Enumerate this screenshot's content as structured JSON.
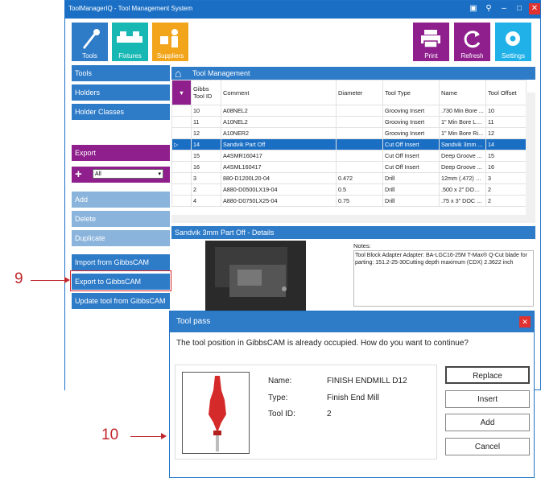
{
  "app": {
    "title": "ToolManagerIQ - Tool Management System"
  },
  "ribbon": {
    "left": [
      {
        "label": "Tools",
        "icon": "tools-icon",
        "color": "#2e7bc8"
      },
      {
        "label": "Fixtures",
        "icon": "fixtures-icon",
        "color": "#17b7b3"
      },
      {
        "label": "Suppliers",
        "icon": "suppliers-icon",
        "color": "#f2a51a"
      }
    ],
    "right": [
      {
        "label": "Print",
        "icon": "print-icon",
        "color": "#8e1f8c"
      },
      {
        "label": "Refresh",
        "icon": "refresh-icon",
        "color": "#8e1f8c"
      },
      {
        "label": "Settings",
        "icon": "gear-icon",
        "color": "#1fb1e8"
      }
    ]
  },
  "sidebar": {
    "nav": [
      "Tools",
      "Holders",
      "Holder Classes"
    ],
    "export_label": "Export",
    "filter_value": "All",
    "actions": [
      "Add",
      "Delete",
      "Duplicate"
    ],
    "gibbs": [
      "Import from GibbsCAM",
      "Export to GibbsCAM",
      "Update tool from GibbsCAM"
    ]
  },
  "main": {
    "header": "Tool Management",
    "columns": [
      "Gibbs Tool ID",
      "Comment",
      "Diameter",
      "Tool Type",
      "Name",
      "Tool Offset"
    ],
    "rows": [
      [
        "10",
        "A08NEL2",
        "",
        "Grooving Insert",
        ".730 Min Bore ...",
        "10"
      ],
      [
        "11",
        "A10NEL2",
        "",
        "Grooving Insert",
        "1\" Min Bore Le...",
        "11"
      ],
      [
        "12",
        "A10NER2",
        "",
        "Grooving Insert",
        "1\" Min Bore Ri...",
        "12"
      ],
      [
        "14",
        "Sandvik Part Off",
        "",
        "Cut Off Insert",
        "Sandvik 3mm ...",
        "14"
      ],
      [
        "15",
        "A4SMR160417",
        "",
        "Cut Off Insert",
        "Deep Groove ...",
        "15"
      ],
      [
        "16",
        "A4SML160417",
        "",
        "Cut Off Insert",
        "Deep Groove ...",
        "16"
      ],
      [
        "3",
        "880-D1200L20-04",
        "0.472",
        "Drill",
        "12mm (.472) x ...",
        "3"
      ],
      [
        "2",
        "A880-D0500LX19-04",
        "0.5",
        "Drill",
        ".500 x 2\" DOC ...",
        "2"
      ],
      [
        "4",
        "A880-D0750LX25-04",
        "0.75",
        "Drill",
        ".75 x 3\" DOC ...",
        "2"
      ]
    ],
    "selected_row": 3,
    "details_header": "Sandvik 3mm Part Off - Details",
    "notes_label": "Notes:",
    "notes_text": "Tool Block Adapter Adapter: BA-LGC16-25M T-Max® Q-Cut blade for parting: 151.2-25-30Cutting depth maximum (CDX) 2.3622 inch"
  },
  "dialog": {
    "title": "Tool pass",
    "message": "The tool position in GibbsCAM is already occupied. How do you want to continue?",
    "name_label": "Name:",
    "name_value": "FINISH ENDMILL D12",
    "type_label": "Type:",
    "type_value": "Finish End Mill",
    "id_label": "Tool ID:",
    "id_value": "2",
    "buttons": [
      "Replace",
      "Insert",
      "Add",
      "Cancel"
    ]
  },
  "callouts": [
    "9",
    "10"
  ]
}
